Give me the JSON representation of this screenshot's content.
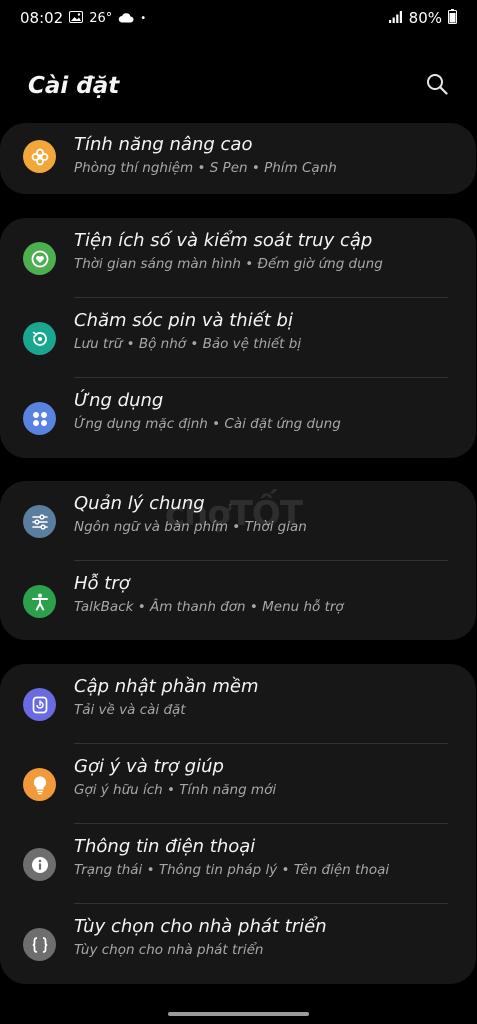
{
  "status_bar": {
    "time": "08:02",
    "temperature": "26°",
    "dot": "•",
    "battery": "80%"
  },
  "header": {
    "title": "Cài đặt"
  },
  "groups": [
    {
      "items": [
        {
          "title": "Tính năng nâng cao",
          "subtitle": "Phòng thí nghiệm • S Pen • Phím Cạnh",
          "icon": "flower-icon",
          "color": "#F2A73B"
        }
      ]
    },
    {
      "items": [
        {
          "title": "Tiện ích số và kiểm soát truy cập",
          "subtitle": "Thời gian sáng màn hình • Đếm giờ ứng dụng",
          "icon": "heart-icon",
          "color": "#4CAF50"
        },
        {
          "title": "Chăm sóc pin và thiết bị",
          "subtitle": "Lưu trữ • Bộ nhớ • Bảo vệ thiết bị",
          "icon": "refresh-icon",
          "color": "#1BA690"
        },
        {
          "title": "Ứng dụng",
          "subtitle": "Ứng dụng mặc định • Cài đặt ứng dụng",
          "icon": "apps-icon",
          "color": "#5A82E0"
        }
      ]
    },
    {
      "items": [
        {
          "title": "Quản lý chung",
          "subtitle": "Ngôn ngữ và bàn phím • Thời gian",
          "icon": "sliders-icon",
          "color": "#5C7E9E"
        },
        {
          "title": "Hỗ trợ",
          "subtitle": "TalkBack • Âm thanh đơn • Menu hỗ trợ",
          "icon": "accessibility-icon",
          "color": "#2BA14E"
        }
      ]
    },
    {
      "items": [
        {
          "title": "Cập nhật phần mềm",
          "subtitle": "Tải về và cài đặt",
          "icon": "update-icon",
          "color": "#6A6BE0"
        },
        {
          "title": "Gợi ý và trợ giúp",
          "subtitle": "Gợi ý hữu ích • Tính năng mới",
          "icon": "lightbulb-icon",
          "color": "#F29A3B"
        },
        {
          "title": "Thông tin điện thoại",
          "subtitle": "Trạng thái • Thông tin pháp lý • Tên điện thoại",
          "icon": "info-icon",
          "color": "#6E6E6E"
        },
        {
          "title": "Tùy chọn cho nhà phát triển",
          "subtitle": "Tùy chọn cho nhà phát triển",
          "icon": "braces-icon",
          "color": "#6E6E6E"
        }
      ]
    }
  ],
  "watermark": "chợTỐT"
}
